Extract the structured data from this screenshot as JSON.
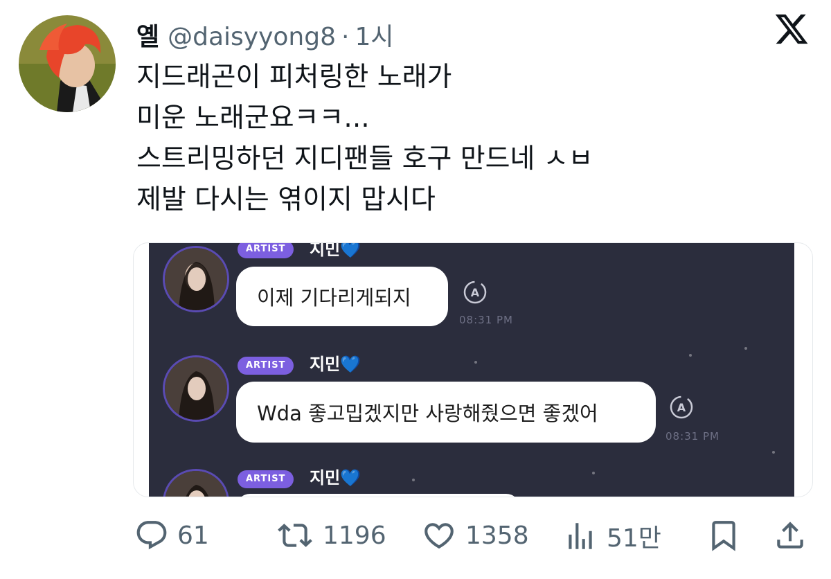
{
  "user": {
    "name": "옐",
    "handle": "@daisyyong8",
    "separator": "·",
    "time": "1시"
  },
  "tweet": {
    "lines": [
      "지드래곤이 피처링한 노래가",
      "미운 노래군요ㅋㅋ...",
      "스트리밍하던 지디팬들 호구 만드네 ㅅㅂ",
      "제발 다시는 엮이지 맙시다"
    ]
  },
  "media": {
    "messages": [
      {
        "badge": "ARTIST",
        "sender": "지민",
        "heart": "💙",
        "text": "이제 기다리게되지",
        "time": "08:31 PM"
      },
      {
        "badge": "ARTIST",
        "sender": "지민",
        "heart": "💙",
        "text": "Wda 좋고밉겠지만 사랑해줬으면 좋겠어",
        "time": "08:31 PM"
      },
      {
        "badge": "ARTIST",
        "sender": "지민",
        "heart": "💙"
      }
    ]
  },
  "actions": {
    "replies": "61",
    "retweets": "1196",
    "likes": "1358",
    "views": "51만"
  },
  "icons": {
    "reply": "reply-icon",
    "retweet": "retweet-icon",
    "like": "heart-icon",
    "views": "views-icon",
    "bookmark": "bookmark-icon",
    "share": "share-icon",
    "logo": "x-logo-icon"
  },
  "colors": {
    "text": "#0f1419",
    "secondary": "#536471",
    "chat_bg": "#2b2d3d",
    "artist_badge": "#7c5fe0",
    "avatar_hair": "#e8452a"
  }
}
